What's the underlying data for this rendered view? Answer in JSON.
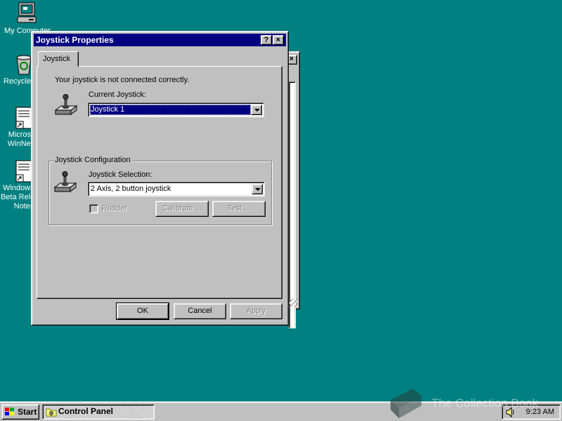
{
  "desktop": {
    "icons": [
      {
        "label": "My Computer",
        "icon": "computer-icon"
      },
      {
        "label": "Recycle Bin",
        "icon": "recycle-bin-icon"
      },
      {
        "label": "Microsoft\nWinNews",
        "icon": "document-shortcut-icon"
      },
      {
        "label": "Windows 95\nBeta Release\nNotes",
        "icon": "document-shortcut-icon"
      }
    ]
  },
  "dialog": {
    "title": "Joystick Properties",
    "help_button": "?",
    "close_button": "×",
    "tab_label": "Joystick",
    "status_message": "Your joystick is not connected correctly.",
    "current_joystick_label": "Current Joystick:",
    "current_joystick_value": "Joystick 1",
    "config_group_label": "Joystick Configuration",
    "selection_label": "Joystick Selection:",
    "selection_value": "2 Axis, 2 button joystick",
    "rudder_label": "Rudder",
    "rudder_checked": false,
    "calibrate_label": "Calibrate ...",
    "test_label": "Test ...",
    "ok_label": "OK",
    "cancel_label": "Cancel",
    "apply_label": "Apply"
  },
  "background_window": {
    "close_button": "×"
  },
  "taskbar": {
    "start_label": "Start",
    "task_label": "Control Panel",
    "clock": "9:23 AM"
  },
  "watermark": {
    "text": "The Collection Book"
  },
  "colors": {
    "desktop": "#008080",
    "titlebar": "#000080",
    "face": "#c0c0c0"
  }
}
